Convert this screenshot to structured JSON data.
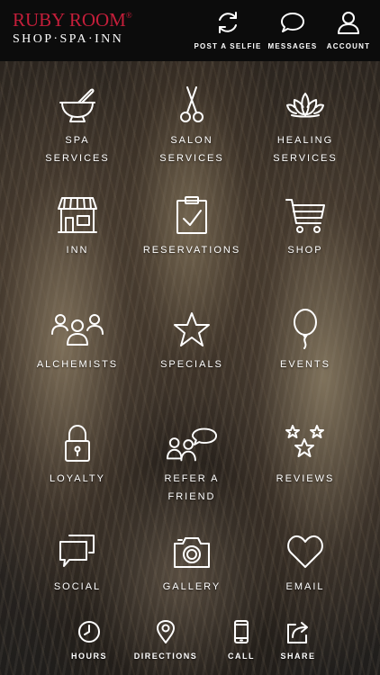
{
  "brand": {
    "name": "RUBY ROOM",
    "mark": "®",
    "tagline": "SHOP·SPA·INN",
    "color": "#c41e3a"
  },
  "header": {
    "actions": [
      {
        "label": "POST A SELFIE",
        "icon": "refresh-camera-icon"
      },
      {
        "label": "MESSAGES",
        "icon": "chat-bubble-icon"
      },
      {
        "label": "ACCOUNT",
        "icon": "person-icon"
      }
    ]
  },
  "grid": [
    {
      "label": "SPA\nSERVICES",
      "icon": "mortar-pestle-icon"
    },
    {
      "label": "SALON\nSERVICES",
      "icon": "scissors-icon"
    },
    {
      "label": "HEALING\nSERVICES",
      "icon": "lotus-icon"
    },
    {
      "label": "INN",
      "icon": "storefront-icon"
    },
    {
      "label": "RESERVATIONS",
      "icon": "clipboard-check-icon"
    },
    {
      "label": "SHOP",
      "icon": "shopping-cart-icon"
    },
    {
      "label": "ALCHEMISTS",
      "icon": "group-icon"
    },
    {
      "label": "SPECIALS",
      "icon": "star-icon"
    },
    {
      "label": "EVENTS",
      "icon": "balloon-icon"
    },
    {
      "label": "LOYALTY",
      "icon": "padlock-icon"
    },
    {
      "label": "REFER A\nFRIEND",
      "icon": "refer-friend-icon"
    },
    {
      "label": "REVIEWS",
      "icon": "three-stars-icon"
    },
    {
      "label": "SOCIAL",
      "icon": "speech-bubbles-icon"
    },
    {
      "label": "GALLERY",
      "icon": "camera-icon"
    },
    {
      "label": "EMAIL",
      "icon": "heart-icon"
    }
  ],
  "bottom": [
    {
      "label": "HOURS",
      "icon": "clock-icon"
    },
    {
      "label": "DIRECTIONS",
      "icon": "map-pin-icon"
    },
    {
      "label": "CALL",
      "icon": "phone-icon"
    },
    {
      "label": "SHARE",
      "icon": "share-icon"
    }
  ]
}
